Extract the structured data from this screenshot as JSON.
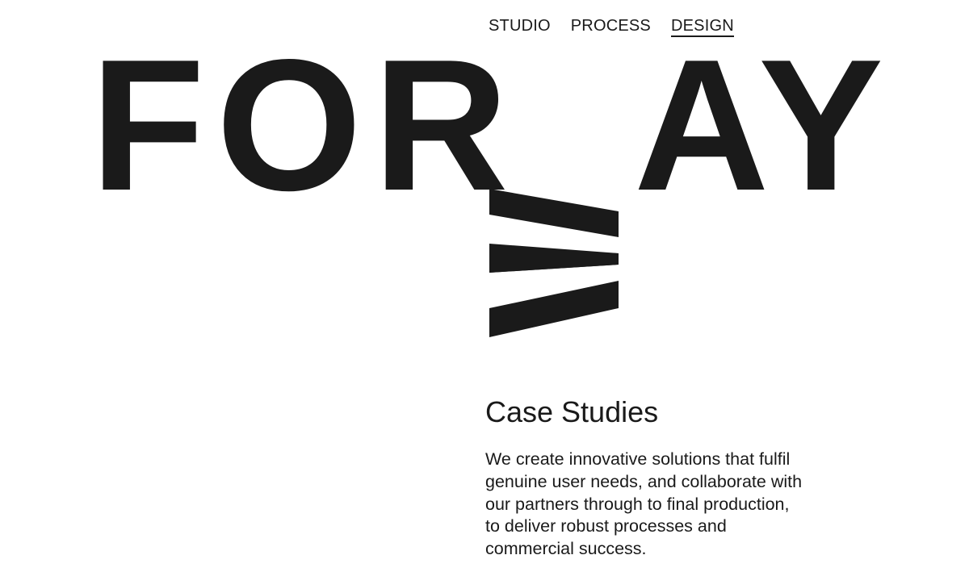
{
  "nav": {
    "items": [
      {
        "label": "STUDIO",
        "active": false
      },
      {
        "label": "PROCESS",
        "active": false
      },
      {
        "label": "DESIGN",
        "active": true
      }
    ]
  },
  "logo": {
    "part1": "FOR",
    "rotated_letter": "W",
    "part2": "AY",
    "color": "#1a1a1a"
  },
  "case_studies": {
    "heading": "Case Studies",
    "body": "We create innovative solutions that fulfil genuine user needs, and collaborate with our partners through to final production, to deliver robust processes and commercial success."
  }
}
